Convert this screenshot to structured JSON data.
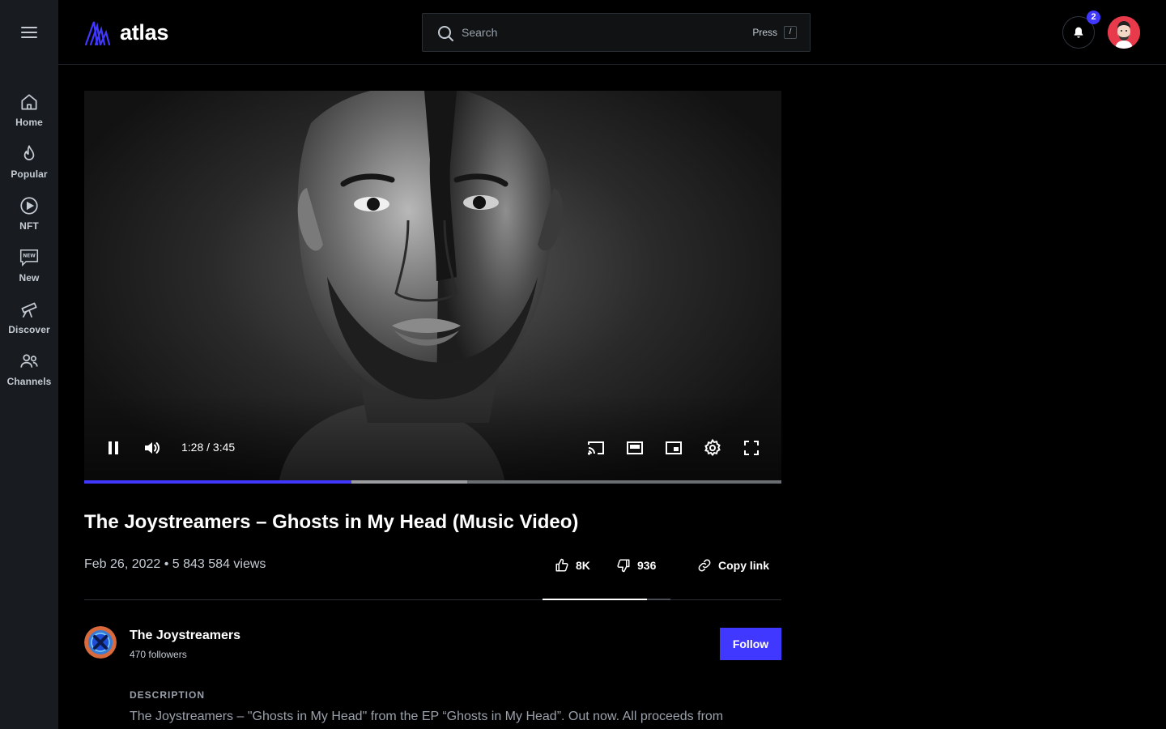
{
  "app": {
    "name": "atlas"
  },
  "sidebar": {
    "menu_icon": "hamburger-icon",
    "items": [
      {
        "label": "Home",
        "icon": "home-icon"
      },
      {
        "label": "Popular",
        "icon": "flame-icon"
      },
      {
        "label": "NFT",
        "icon": "play-circle-icon"
      },
      {
        "label": "New",
        "icon": "new-badge-icon"
      },
      {
        "label": "Discover",
        "icon": "telescope-icon"
      },
      {
        "label": "Channels",
        "icon": "people-icon"
      }
    ]
  },
  "header": {
    "search": {
      "placeholder": "Search",
      "hint_label": "Press",
      "hint_key": "/"
    },
    "notifications": {
      "count": "2"
    }
  },
  "player": {
    "state": "playing",
    "current_time": "1:28",
    "duration": "3:45",
    "time_display": "1:28 / 3:45",
    "progress_played": 0.3833,
    "progress_buffered": 0.549,
    "colors": {
      "accent": "#4038ff"
    }
  },
  "video": {
    "title": "The Joystreamers – Ghosts in My Head (Music Video)",
    "date": "Feb 26, 2022",
    "views": "5 843 584 views",
    "meta_line": "Feb 26, 2022 • 5 843 584 views",
    "likes": "8K",
    "dislikes": "936",
    "copy_link_label": "Copy link",
    "reaction_like_ratio": 0.8161
  },
  "channel": {
    "name": "The Joystreamers",
    "followers": "470 followers",
    "follow_label": "Follow"
  },
  "description": {
    "label": "DESCRIPTION",
    "text": "The Joystreamers – \"Ghosts in My Head\" from the EP “Ghosts in My Head”. Out now. All proceeds from"
  }
}
